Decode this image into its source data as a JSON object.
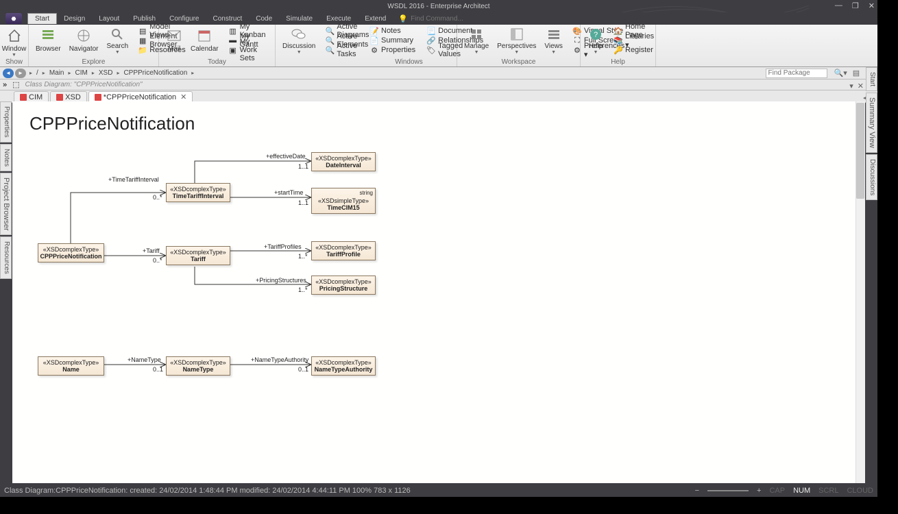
{
  "title": "WSDL 2016 - Enterprise Architect",
  "menubar": [
    "Start",
    "Design",
    "Layout",
    "Publish",
    "Configure",
    "Construct",
    "Code",
    "Simulate",
    "Execute",
    "Extend"
  ],
  "find_cmd_placeholder": "Find Command...",
  "ribbon": {
    "show": {
      "window": "Window",
      "label": "Show"
    },
    "explore": {
      "browser": "Browser",
      "navigator": "Navigator",
      "search": "Search",
      "model_views": "Model Views",
      "element_browser": "Element Browser",
      "resources": "Resources",
      "label": "Explore"
    },
    "today": {
      "mail": "Mail",
      "calendar": "Calendar",
      "my_kanban": "My Kanban",
      "my_gantt": "My Gantt",
      "my_work_sets": "My Work Sets",
      "label": "Today"
    },
    "discussion": {
      "discussion": "Discussion",
      "active_diagrams": "Active Diagrams",
      "active_elements": "Active Elements",
      "active_tasks": "Active Tasks"
    },
    "windows": {
      "notes": "Notes",
      "summary": "Summary",
      "properties": "Properties",
      "document": "Document",
      "relationships": "Relationships",
      "tagged_values": "Tagged Values",
      "label": "Windows"
    },
    "workspace": {
      "manage": "Manage",
      "perspectives": "Perspectives",
      "views": "Views",
      "visual_style": "Visual Style",
      "full_screen": "Full Screen",
      "preferences": "Preferences ▾",
      "label": "Workspace"
    },
    "help": {
      "help": "Help",
      "home_page": "Home Page",
      "libraries": "Libraries ▾",
      "register": "Register",
      "label": "Help"
    }
  },
  "breadcrumb": [
    "Main",
    "CIM",
    "XSD",
    "CPPPriceNotification"
  ],
  "find_pkg_placeholder": "Find Package",
  "diagram_label": "Class Diagram: \"CPPPriceNotification\"",
  "tabs": {
    "cim": "CIM",
    "xsd": "XSD",
    "active": "*CPPPriceNotification"
  },
  "side_left": [
    "Properties",
    "Notes",
    "Project Browser",
    "Resources"
  ],
  "side_right": [
    "Start",
    "Summary View",
    "Discussions"
  ],
  "diagram": {
    "title": "CPPPriceNotification",
    "elements": {
      "cpp": {
        "stereo": "«XSDcomplexType»",
        "name": "CPPPriceNotification"
      },
      "tti": {
        "stereo": "«XSDcomplexType»",
        "name": "TimeTariffInterval"
      },
      "di": {
        "stereo": "«XSDcomplexType»",
        "name": "DateInterval"
      },
      "tc": {
        "stereo": "«XSDsimpleType»",
        "name": "TimeCIM15",
        "attr": "string"
      },
      "tariff": {
        "stereo": "«XSDcomplexType»",
        "name": "Tariff"
      },
      "tp": {
        "stereo": "«XSDcomplexType»",
        "name": "TariffProfile"
      },
      "ps": {
        "stereo": "«XSDcomplexType»",
        "name": "PricingStructure"
      },
      "nm": {
        "stereo": "«XSDcomplexType»",
        "name": "Name"
      },
      "nt": {
        "stereo": "«XSDcomplexType»",
        "name": "NameType"
      },
      "nta": {
        "stereo": "«XSDcomplexType»",
        "name": "NameTypeAuthority"
      }
    },
    "roles": {
      "tti": "+TimeTariffInterval",
      "ed": "+effectiveDate",
      "st": "+startTime",
      "tariff": "+Tariff",
      "tp": "+TariffProfiles",
      "ps": "+PricingStructures",
      "nt": "+NameType",
      "nta": "+NameTypeAuthority"
    },
    "mults": {
      "m0s": "0..*",
      "m11": "1..1",
      "m1s": "1..*",
      "m01": "0..1"
    }
  },
  "status": {
    "left": "Class Diagram:CPPPriceNotification:   created: 24/02/2014 1:48:44 PM  modified: 24/02/2014 4:44:11 PM   100%   783 x 1126",
    "cap": "CAP",
    "num": "NUM",
    "scrl": "SCRL",
    "cloud": "CLOUD"
  }
}
